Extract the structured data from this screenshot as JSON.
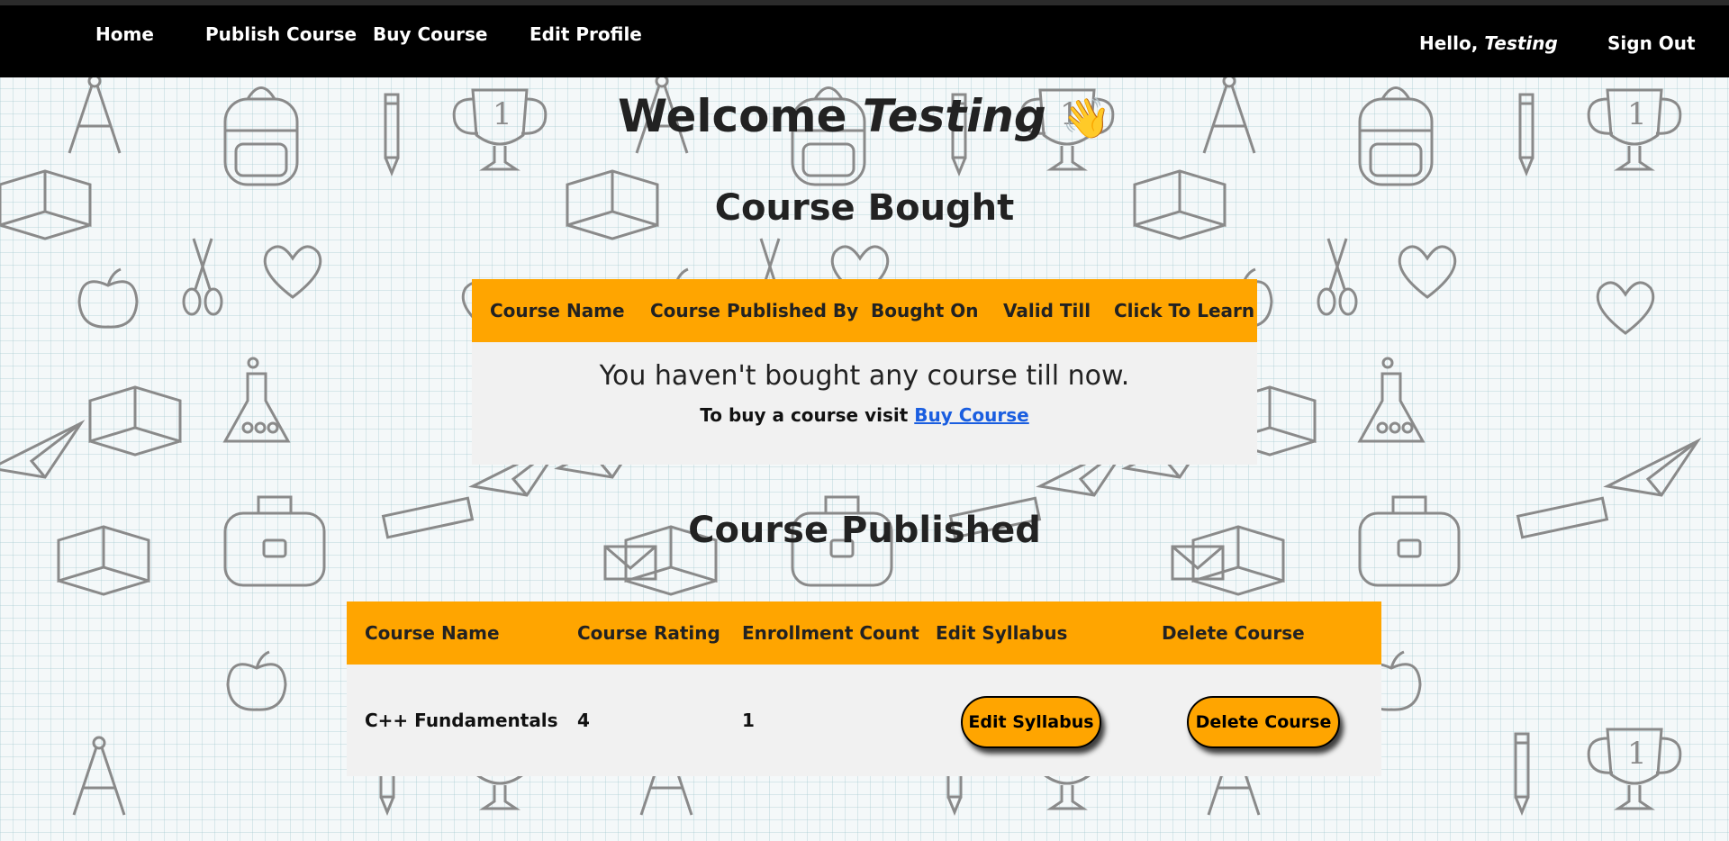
{
  "nav": {
    "links": [
      "Home",
      "Publish Course",
      "Buy Course",
      "Edit Profile"
    ],
    "greeting_prefix": "Hello,",
    "username": "Testing",
    "sign_out": "Sign Out"
  },
  "welcome": {
    "prefix": "Welcome",
    "name": "Testing",
    "emoji": "👋"
  },
  "bought": {
    "title": "Course Bought",
    "columns": [
      "Course Name",
      "Course Published By",
      "Bought On",
      "Valid Till",
      "Click To Learn"
    ],
    "empty_message": "You haven't bought any course till now.",
    "empty_sub_prefix": "To buy a course visit",
    "empty_sub_link": "Buy Course"
  },
  "published": {
    "title": "Course Published",
    "columns": [
      "Course Name",
      "Course Rating",
      "Enrollment Count",
      "Edit Syllabus",
      "Delete Course"
    ],
    "rows": [
      {
        "name": "C++ Fundamentals",
        "rating": "4",
        "enrollment": "1",
        "edit_label": "Edit Syllabus",
        "delete_label": "Delete Course"
      }
    ]
  },
  "colors": {
    "accent": "#ffa500",
    "navbar": "#000000",
    "link": "#1a5ee0",
    "table_body": "#f1f1f1"
  }
}
